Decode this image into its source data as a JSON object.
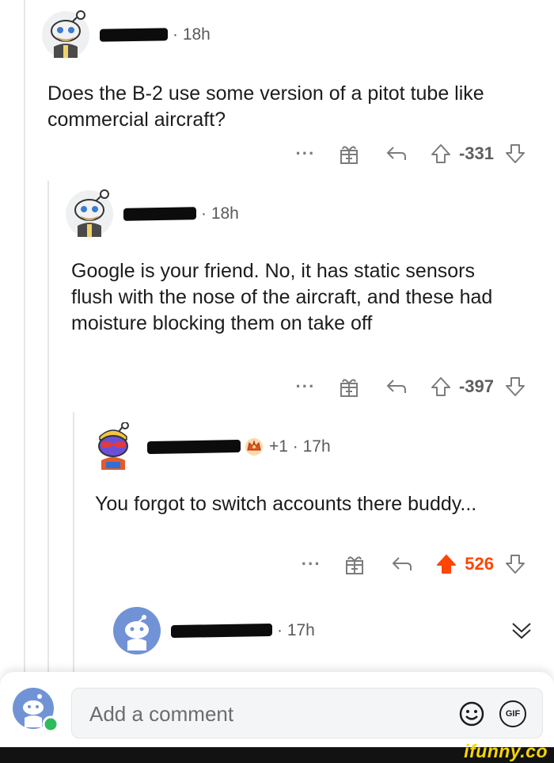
{
  "thread": {
    "comments": [
      {
        "time": "· 18h",
        "body": "Does the B-2 use some version of a pitot tube like commercial aircraft?",
        "actions": {
          "more": "···",
          "score": "-331"
        }
      },
      {
        "time": "· 18h",
        "body": "Google is your friend. No, it has static sensors flush with the nose of the aircraft, and these had moisture blocking them on take off",
        "actions": {
          "more": "···",
          "score": "-397"
        }
      },
      {
        "time": "+1 · 17h",
        "body": "You forgot to switch accounts there buddy...",
        "actions": {
          "more": "···",
          "score": "526"
        }
      },
      {
        "time": "· 17h"
      }
    ]
  },
  "composer": {
    "placeholder": "Add a comment",
    "gif_label": "GIF"
  },
  "watermark": "ifunny.co",
  "colors": {
    "upvote_active": "#ff4500",
    "score_neutral": "#5f5f61",
    "thread_line": "#e6e6e6"
  }
}
